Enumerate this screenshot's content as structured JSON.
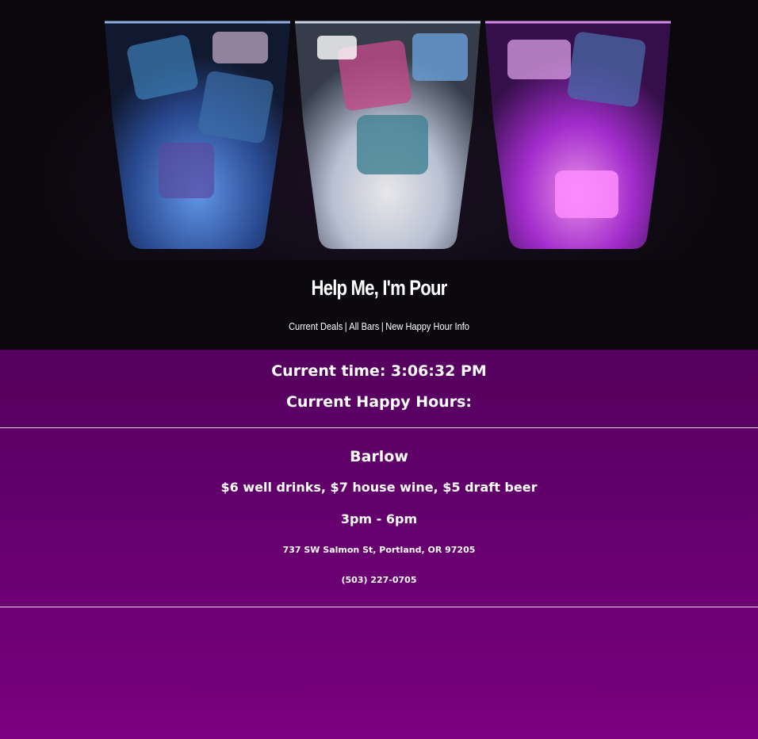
{
  "site": {
    "title": "Help Me, I'm Pour",
    "nav": {
      "current_deals": "Current Deals",
      "separator": "|",
      "all_bars": "All Bars",
      "new_info": "New Happy Hour Info"
    }
  },
  "status": {
    "current_time": "Current time: 3:06:32 PM",
    "heading": "Current Happy Hours:"
  },
  "listings": [
    {
      "name": "Barlow",
      "deals": "$6 well drinks, $7 house wine, $5 draft beer",
      "hours": "3pm - 6pm",
      "address": "737 SW Salmon St, Portland, OR 97205",
      "phone": "(503) 227-0705"
    }
  ],
  "colors": {
    "background_top": "#3d0040",
    "background_bottom": "#7a0080",
    "header_bg": "#0b090d",
    "text": "#ffffff",
    "glass_blue": "#4a7fd6",
    "glass_white": "#e8f0ff",
    "glass_purple": "#c040ff"
  },
  "hero_image": {
    "subject": "three-glasses-of-iced-drinks-lit-blue-white-purple"
  }
}
